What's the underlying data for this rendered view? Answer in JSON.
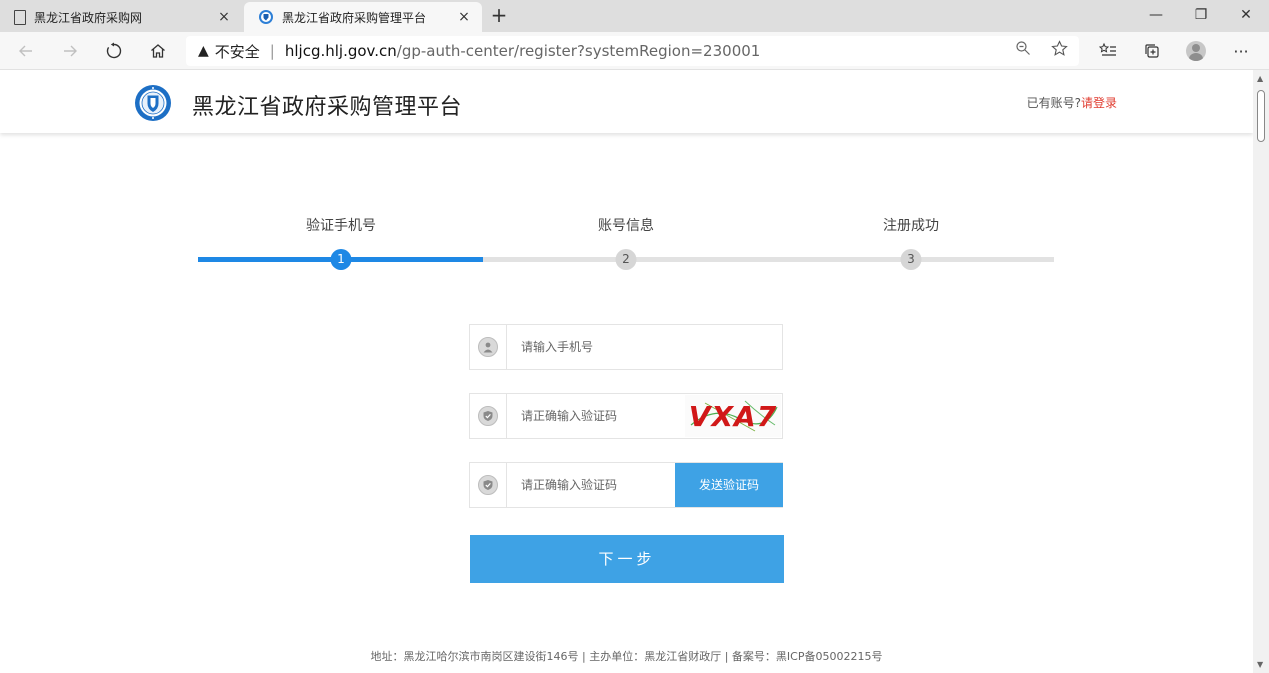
{
  "browser": {
    "tabs": [
      {
        "title": "黑龙江省政府采购网",
        "close": "×"
      },
      {
        "title": "黑龙江省政府采购管理平台",
        "close": "×"
      }
    ],
    "new_tab": "+",
    "window": {
      "minimize": "—",
      "restore": "❐",
      "close": "✕"
    },
    "address": {
      "warning_icon": "▲",
      "insecure_label": "不安全",
      "separator": "|",
      "host": "hljcg.hlj.gov.cn",
      "path": "/gp-auth-center/register?systemRegion=230001"
    },
    "toolbar_icons": [
      "back-icon",
      "forward-icon",
      "refresh-icon",
      "home-icon",
      "zoom-icon",
      "favorite-star-icon",
      "favorites-list-icon",
      "collections-icon",
      "profile-icon",
      "more-icon"
    ]
  },
  "header": {
    "site_title": "黑龙江省政府采购管理平台",
    "login_hint": "已有账号?",
    "login_link": "请登录"
  },
  "steps": {
    "items": [
      {
        "label": "验证手机号",
        "number": "1"
      },
      {
        "label": "账号信息",
        "number": "2"
      },
      {
        "label": "注册成功",
        "number": "3"
      }
    ],
    "active_step": 1,
    "progress_fraction": 0.333,
    "active_color": "#1e88e5"
  },
  "form": {
    "phone_placeholder": "请输入手机号",
    "captcha_placeholder": "请正确输入验证码",
    "captcha_text": "VXA7",
    "sms_placeholder": "请正确输入验证码",
    "send_code_button": "发送验证码",
    "next_button": "下一步"
  },
  "footer": {
    "text": "地址：黑龙江哈尔滨市南岗区建设街146号  |   主办单位：黑龙江省财政厅   |   备案号：黑ICP备05002215号"
  },
  "colors": {
    "primary_button": "#3ea2e5",
    "login_link": "#e03b2f"
  }
}
